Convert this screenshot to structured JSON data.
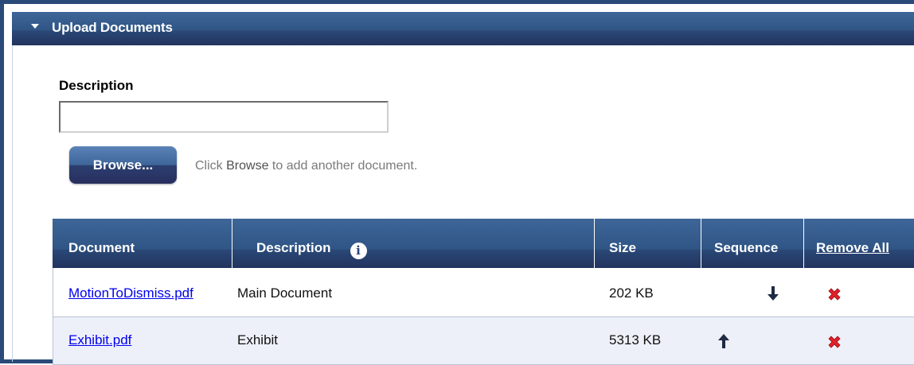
{
  "panel": {
    "title": "Upload Documents"
  },
  "form": {
    "description_label": "Description",
    "description_value": "",
    "browse_label": "Browse...",
    "hint_prefix": "Click ",
    "hint_bold": "Browse",
    "hint_suffix": " to add another document."
  },
  "table": {
    "headers": {
      "document": "Document",
      "description": "Description",
      "size": "Size",
      "sequence": "Sequence",
      "remove_all": "Remove All"
    },
    "rows": [
      {
        "document": "MotionToDismiss.pdf",
        "description": "Main Document",
        "size": "202 KB",
        "sequence": "down"
      },
      {
        "document": "Exhibit.pdf",
        "description": "Exhibit",
        "size": "5313 KB",
        "sequence": "up"
      }
    ]
  },
  "icons": {
    "panel_toggle": "caret-down-icon",
    "info": "info-icon",
    "move_down": "arrow-down-icon",
    "move_up": "arrow-up-icon",
    "remove": "red-x-icon"
  },
  "colors": {
    "header_blue": "#2f5585",
    "header_dark": "#22345e",
    "link": "#0000ee",
    "remove_red": "#e0202a",
    "alt_row": "#eef0f9"
  }
}
